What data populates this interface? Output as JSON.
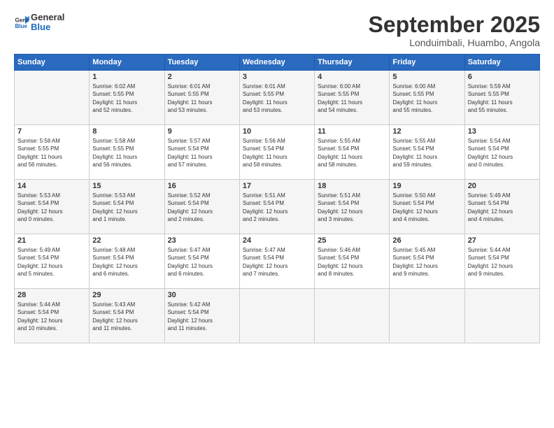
{
  "logo": {
    "general": "General",
    "blue": "Blue"
  },
  "title": "September 2025",
  "location": "Londuimbali, Huambo, Angola",
  "days_header": [
    "Sunday",
    "Monday",
    "Tuesday",
    "Wednesday",
    "Thursday",
    "Friday",
    "Saturday"
  ],
  "weeks": [
    [
      {
        "day": "",
        "info": ""
      },
      {
        "day": "1",
        "info": "Sunrise: 6:02 AM\nSunset: 5:55 PM\nDaylight: 11 hours\nand 52 minutes."
      },
      {
        "day": "2",
        "info": "Sunrise: 6:01 AM\nSunset: 5:55 PM\nDaylight: 11 hours\nand 53 minutes."
      },
      {
        "day": "3",
        "info": "Sunrise: 6:01 AM\nSunset: 5:55 PM\nDaylight: 11 hours\nand 53 minutes."
      },
      {
        "day": "4",
        "info": "Sunrise: 6:00 AM\nSunset: 5:55 PM\nDaylight: 11 hours\nand 54 minutes."
      },
      {
        "day": "5",
        "info": "Sunrise: 6:00 AM\nSunset: 5:55 PM\nDaylight: 11 hours\nand 55 minutes."
      },
      {
        "day": "6",
        "info": "Sunrise: 5:59 AM\nSunset: 5:55 PM\nDaylight: 11 hours\nand 55 minutes."
      }
    ],
    [
      {
        "day": "7",
        "info": "Sunrise: 5:58 AM\nSunset: 5:55 PM\nDaylight: 11 hours\nand 56 minutes."
      },
      {
        "day": "8",
        "info": "Sunrise: 5:58 AM\nSunset: 5:55 PM\nDaylight: 11 hours\nand 56 minutes."
      },
      {
        "day": "9",
        "info": "Sunrise: 5:57 AM\nSunset: 5:54 PM\nDaylight: 11 hours\nand 57 minutes."
      },
      {
        "day": "10",
        "info": "Sunrise: 5:56 AM\nSunset: 5:54 PM\nDaylight: 11 hours\nand 58 minutes."
      },
      {
        "day": "11",
        "info": "Sunrise: 5:55 AM\nSunset: 5:54 PM\nDaylight: 11 hours\nand 58 minutes."
      },
      {
        "day": "12",
        "info": "Sunrise: 5:55 AM\nSunset: 5:54 PM\nDaylight: 11 hours\nand 59 minutes."
      },
      {
        "day": "13",
        "info": "Sunrise: 5:54 AM\nSunset: 5:54 PM\nDaylight: 12 hours\nand 0 minutes."
      }
    ],
    [
      {
        "day": "14",
        "info": "Sunrise: 5:53 AM\nSunset: 5:54 PM\nDaylight: 12 hours\nand 0 minutes."
      },
      {
        "day": "15",
        "info": "Sunrise: 5:53 AM\nSunset: 5:54 PM\nDaylight: 12 hours\nand 1 minute."
      },
      {
        "day": "16",
        "info": "Sunrise: 5:52 AM\nSunset: 5:54 PM\nDaylight: 12 hours\nand 2 minutes."
      },
      {
        "day": "17",
        "info": "Sunrise: 5:51 AM\nSunset: 5:54 PM\nDaylight: 12 hours\nand 2 minutes."
      },
      {
        "day": "18",
        "info": "Sunrise: 5:51 AM\nSunset: 5:54 PM\nDaylight: 12 hours\nand 3 minutes."
      },
      {
        "day": "19",
        "info": "Sunrise: 5:50 AM\nSunset: 5:54 PM\nDaylight: 12 hours\nand 4 minutes."
      },
      {
        "day": "20",
        "info": "Sunrise: 5:49 AM\nSunset: 5:54 PM\nDaylight: 12 hours\nand 4 minutes."
      }
    ],
    [
      {
        "day": "21",
        "info": "Sunrise: 5:49 AM\nSunset: 5:54 PM\nDaylight: 12 hours\nand 5 minutes."
      },
      {
        "day": "22",
        "info": "Sunrise: 5:48 AM\nSunset: 5:54 PM\nDaylight: 12 hours\nand 6 minutes."
      },
      {
        "day": "23",
        "info": "Sunrise: 5:47 AM\nSunset: 5:54 PM\nDaylight: 12 hours\nand 6 minutes."
      },
      {
        "day": "24",
        "info": "Sunrise: 5:47 AM\nSunset: 5:54 PM\nDaylight: 12 hours\nand 7 minutes."
      },
      {
        "day": "25",
        "info": "Sunrise: 5:46 AM\nSunset: 5:54 PM\nDaylight: 12 hours\nand 8 minutes."
      },
      {
        "day": "26",
        "info": "Sunrise: 5:45 AM\nSunset: 5:54 PM\nDaylight: 12 hours\nand 9 minutes."
      },
      {
        "day": "27",
        "info": "Sunrise: 5:44 AM\nSunset: 5:54 PM\nDaylight: 12 hours\nand 9 minutes."
      }
    ],
    [
      {
        "day": "28",
        "info": "Sunrise: 5:44 AM\nSunset: 5:54 PM\nDaylight: 12 hours\nand 10 minutes."
      },
      {
        "day": "29",
        "info": "Sunrise: 5:43 AM\nSunset: 5:54 PM\nDaylight: 12 hours\nand 11 minutes."
      },
      {
        "day": "30",
        "info": "Sunrise: 5:42 AM\nSunset: 5:54 PM\nDaylight: 12 hours\nand 11 minutes."
      },
      {
        "day": "",
        "info": ""
      },
      {
        "day": "",
        "info": ""
      },
      {
        "day": "",
        "info": ""
      },
      {
        "day": "",
        "info": ""
      }
    ]
  ]
}
